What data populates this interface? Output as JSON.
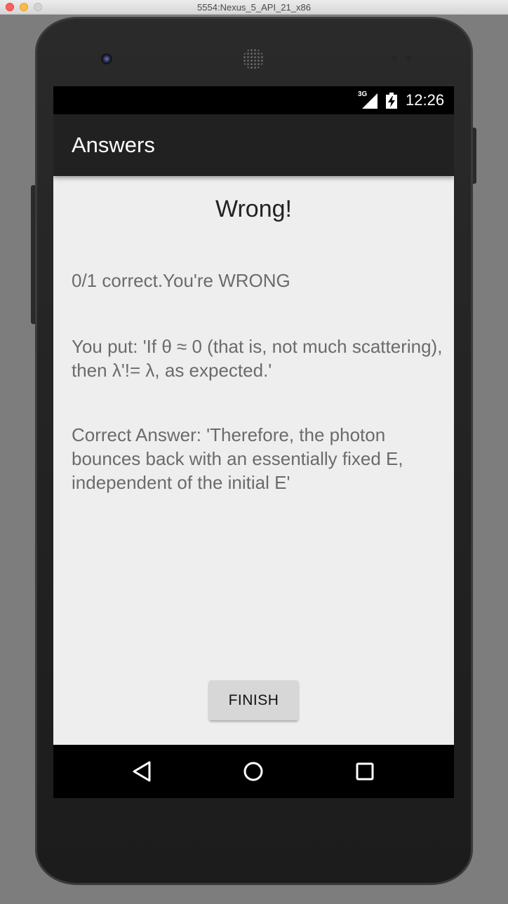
{
  "window": {
    "title": "5554:Nexus_5_API_21_x86"
  },
  "status_bar": {
    "network": "3G",
    "time": "12:26",
    "icons": [
      "signal-icon",
      "battery-charging-icon"
    ]
  },
  "app_bar": {
    "title": "Answers"
  },
  "main": {
    "heading": "Wrong!",
    "score_text": "0/1 correct.You're WRONG",
    "user_answer_text": "You put: 'If θ ≈ 0 (that is, not much scattering), then λ'!= λ, as expected.'",
    "correct_answer_text": "Correct Answer: 'Therefore, the photon bounces back with an essentially fixed E, independent of the initial E'",
    "finish_label": "FINISH"
  },
  "nav_bar": {
    "icons": [
      "back-icon",
      "home-icon",
      "recents-icon"
    ]
  },
  "colors": {
    "app_bar": "#212121",
    "content_bg": "#eeeeee",
    "body_text": "#6b6b6b",
    "button_bg": "#d7d7d7"
  }
}
